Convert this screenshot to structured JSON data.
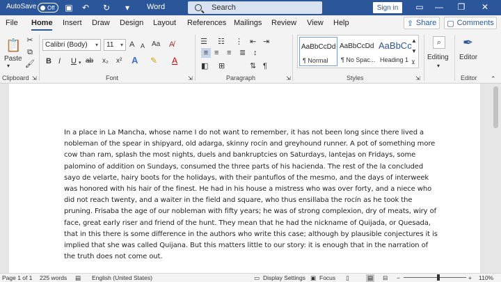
{
  "titlebar": {
    "autosave_label": "AutoSave",
    "autosave_state": "Off",
    "app_title": "Word",
    "search_placeholder": "Search",
    "signin_label": "Sign in"
  },
  "menu": {
    "items": [
      "File",
      "Home",
      "Insert",
      "Draw",
      "Design",
      "Layout",
      "References",
      "Mailings",
      "Review",
      "View",
      "Help"
    ],
    "share_label": "Share",
    "comments_label": "Comments"
  },
  "ribbon": {
    "clipboard": {
      "paste_label": "Paste",
      "group_label": "Clipboard"
    },
    "font": {
      "font_name": "Calibri (Body)",
      "font_size": "11",
      "group_label": "Font",
      "bold": "B",
      "italic": "I",
      "underline": "U",
      "strike": "ab",
      "subscript": "x₂",
      "superscript": "x²",
      "grow": "A",
      "shrink": "A",
      "case": "Aa"
    },
    "paragraph": {
      "group_label": "Paragraph"
    },
    "styles": {
      "group_label": "Styles",
      "items": [
        {
          "preview": "AaBbCcDd",
          "name": "¶ Normal"
        },
        {
          "preview": "AaBbCcDd",
          "name": "¶ No Spac..."
        },
        {
          "preview": "AaBbCc",
          "name": "Heading 1"
        }
      ]
    },
    "editing": {
      "label": "Editing"
    },
    "editor": {
      "label": "Editor",
      "group_label": "Editor"
    }
  },
  "document": {
    "body": "In a place in La Mancha, whose name I do not want to remember, it has not been long since there lived a nobleman of the spear in shipyard, old adarga, skinny rocín and greyhound runner. A pot of something more cow than ram, splash the most nights, duels and bankruptcies on Saturdays, lantejas on Fridays, some palomino of addition on Sundays, consumed the three parts of his hacienda. The rest of the la concluded sayo de velarte, hairy boots for the holidays, with their pantuflos of the mesmo, and the days of interweek was honored with his hair of the finest. He had in his house a mistress who was over forty, and a niece who did not reach twenty, and a waiter in the field and square, who thus ensillaba the rocín as he took the pruning. Frisaba the age of our nobleman with fifty years; he was of strong complexion, dry of meats, wiry of face, great early riser and friend of the hunt. They mean that he had the nickname of Quijada, or Quesada, that in this there is some difference in the authors who write this case; although by plausible conjectures it is implied that she was called Quijana. But this matters little to our story: it is enough that in the narration of the truth does not come out."
  },
  "statusbar": {
    "page": "Page 1 of 1",
    "words": "225 words",
    "language": "English (United States)",
    "display_settings": "Display Settings",
    "focus": "Focus",
    "zoom": "110%",
    "zoom_fraction": 0.55
  },
  "colors": {
    "accent": "#2b579a",
    "ribbon_bg": "#f3f3f3",
    "page_bg": "#ffffff"
  }
}
